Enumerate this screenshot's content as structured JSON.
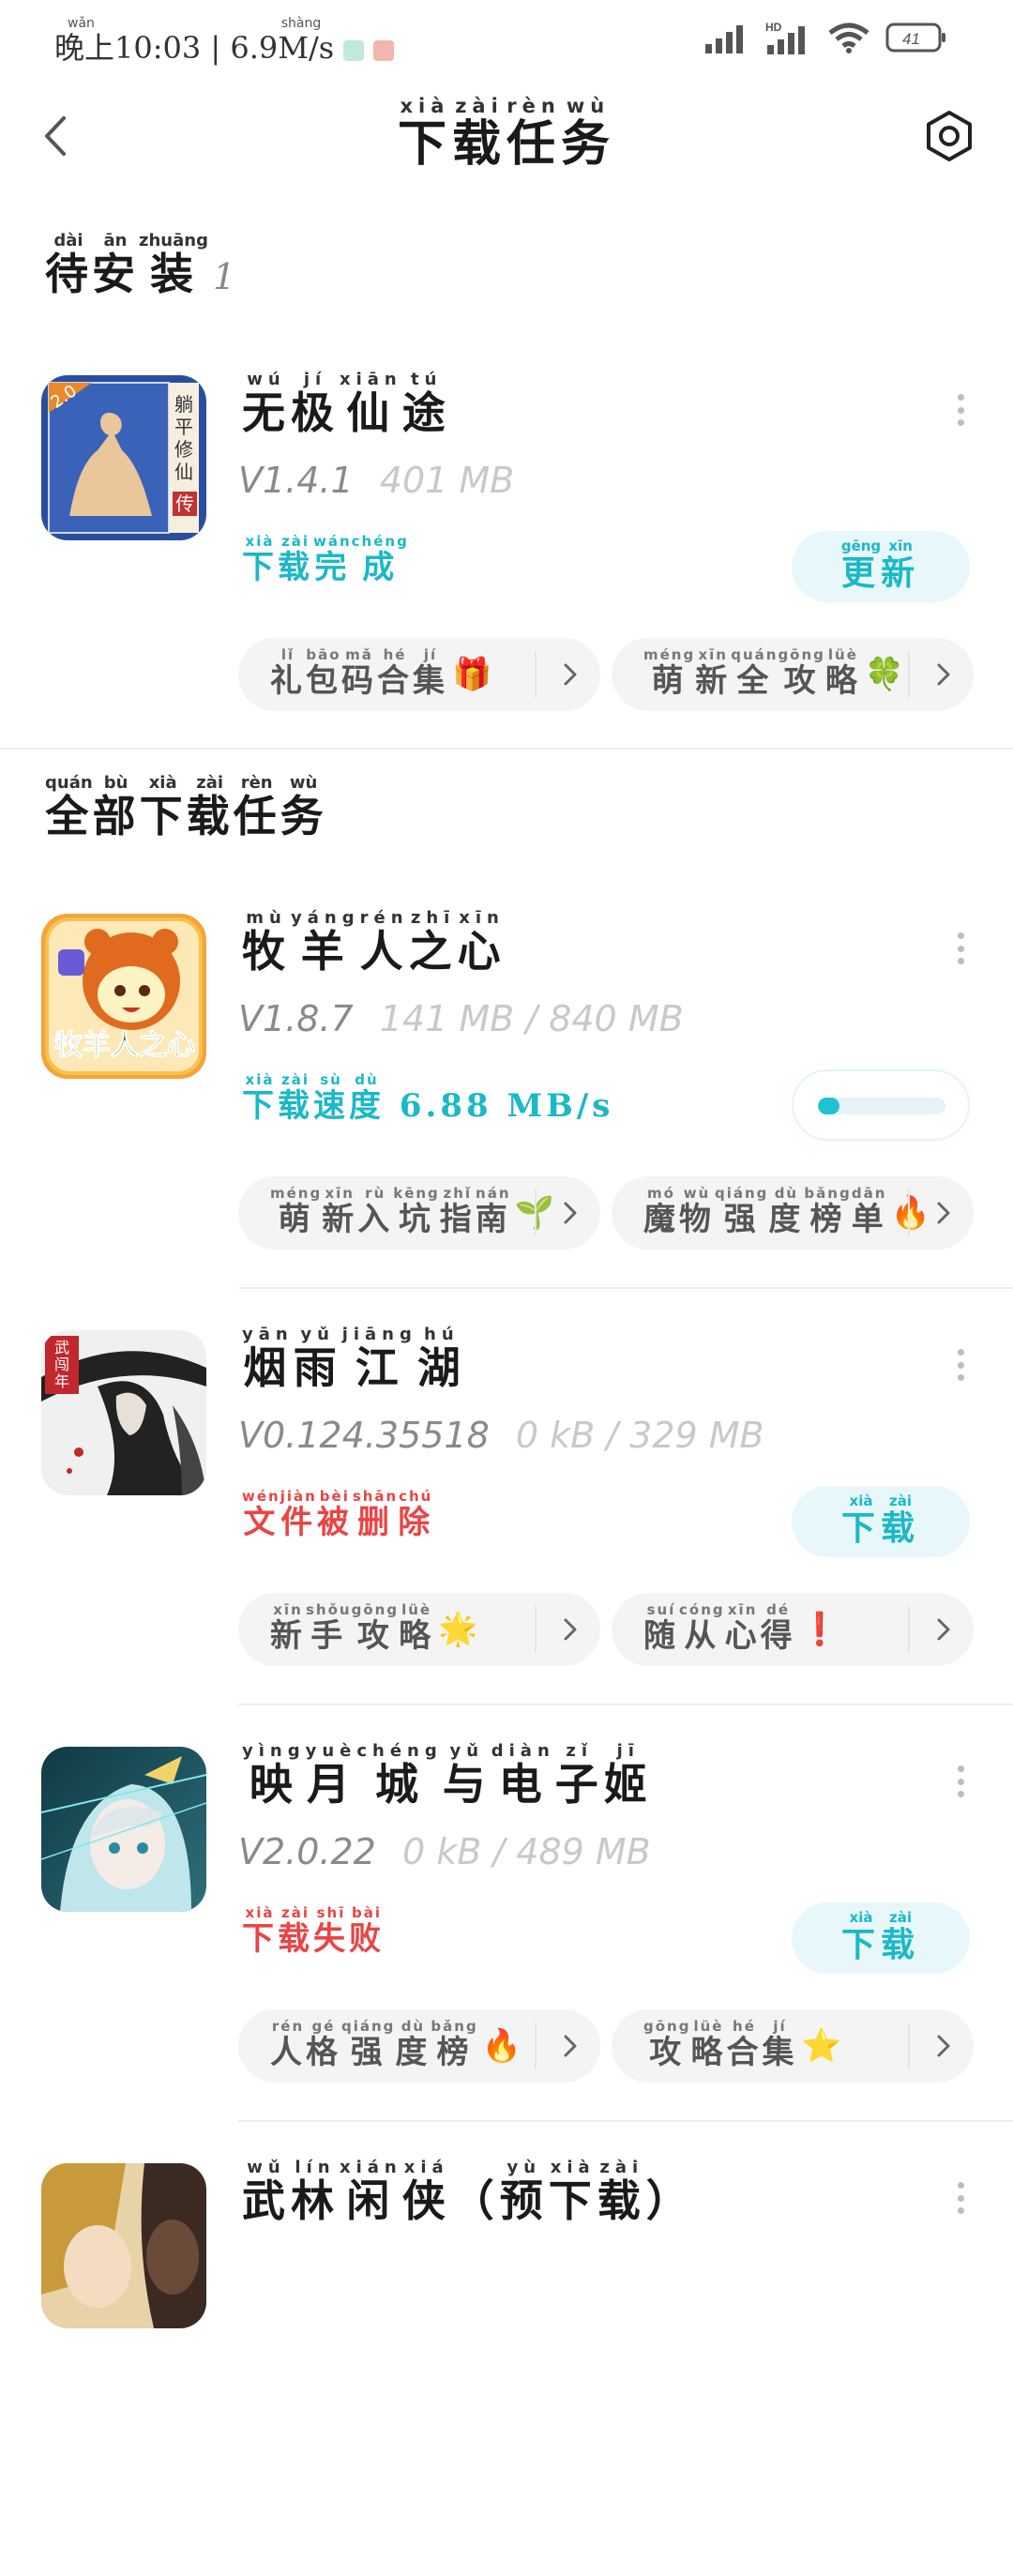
{
  "status_bar": {
    "time_pinyin": "wǎn shàng",
    "time_label": "晚上10:03 | 6.9M/s",
    "battery": "41"
  },
  "header": {
    "title_chars": [
      {
        "c": "下",
        "p": "xià"
      },
      {
        "c": "载",
        "p": "zài"
      },
      {
        "c": "任",
        "p": "rèn"
      },
      {
        "c": "务",
        "p": "wù"
      }
    ]
  },
  "pending_section": {
    "title_chars": [
      {
        "c": "待",
        "p": "dài"
      },
      {
        "c": "安",
        "p": "ān"
      },
      {
        "c": "装",
        "p": "zhuāng"
      }
    ],
    "count": "1"
  },
  "all_section": {
    "title_chars": [
      {
        "c": "全",
        "p": "quán"
      },
      {
        "c": "部",
        "p": "bù"
      },
      {
        "c": "下",
        "p": "xià"
      },
      {
        "c": "载",
        "p": "zài"
      },
      {
        "c": "任",
        "p": "rèn"
      },
      {
        "c": "务",
        "p": "wù"
      }
    ]
  },
  "apps": [
    {
      "name": [
        {
          "c": "无",
          "p": "wú"
        },
        {
          "c": "极",
          "p": "jí"
        },
        {
          "c": "仙",
          "p": "xiān"
        },
        {
          "c": "途",
          "p": "tú"
        }
      ],
      "version": "V1.4.1",
      "size": "401 MB",
      "status_type": "ok",
      "status": [
        {
          "c": "下",
          "p": "xià"
        },
        {
          "c": "载",
          "p": "zài"
        },
        {
          "c": "完",
          "p": "wán"
        },
        {
          "c": "成",
          "p": "chéng"
        }
      ],
      "action": [
        {
          "c": "更",
          "p": "gēng"
        },
        {
          "c": "新",
          "p": "xīn"
        }
      ],
      "icon_colors": [
        "#2a4e9e",
        "#e9c79a",
        "#c2322e"
      ],
      "icon_badge": "2.0",
      "icon_side": "躺平修仙",
      "icon_seal": "传",
      "chips": [
        {
          "text": [
            {
              "c": "礼",
              "p": "lǐ"
            },
            {
              "c": "包",
              "p": "bāo"
            },
            {
              "c": "码",
              "p": "mǎ"
            },
            {
              "c": "合",
              "p": "hé"
            },
            {
              "c": "集",
              "p": "jí"
            }
          ],
          "emoji": "🎁"
        },
        {
          "text": [
            {
              "c": "萌",
              "p": "méng"
            },
            {
              "c": "新",
              "p": "xīn"
            },
            {
              "c": "全",
              "p": "quán"
            },
            {
              "c": "攻",
              "p": "gōng"
            },
            {
              "c": "略",
              "p": "lüè"
            }
          ],
          "emoji": "🍀"
        }
      ]
    },
    {
      "name": [
        {
          "c": "牧",
          "p": "mù"
        },
        {
          "c": "羊",
          "p": "yáng"
        },
        {
          "c": "人",
          "p": "rén"
        },
        {
          "c": "之",
          "p": "zhī"
        },
        {
          "c": "心",
          "p": "xīn"
        }
      ],
      "version": "V1.8.7",
      "size": "141 MB / 840 MB",
      "status_type": "ok",
      "status": [
        {
          "c": "下",
          "p": "xià"
        },
        {
          "c": "载",
          "p": "zài"
        },
        {
          "c": "速",
          "p": "sù"
        },
        {
          "c": "度",
          "p": "dù"
        }
      ],
      "status_suffix": " 6.88 MB/s",
      "progress": 0.17,
      "icon_colors": [
        "#f4a43a",
        "#e06a1e",
        "#fff3c4"
      ],
      "icon_text": "牧羊人之心",
      "chips": [
        {
          "text": [
            {
              "c": "萌",
              "p": "méng"
            },
            {
              "c": "新",
              "p": "xīn"
            },
            {
              "c": "入",
              "p": "rù"
            },
            {
              "c": "坑",
              "p": "kēng"
            },
            {
              "c": "指",
              "p": "zhǐ"
            },
            {
              "c": "南",
              "p": "nán"
            }
          ],
          "emoji": "🌱"
        },
        {
          "text": [
            {
              "c": "魔",
              "p": "mó"
            },
            {
              "c": "物",
              "p": "wù"
            },
            {
              "c": "强",
              "p": "qiáng"
            },
            {
              "c": "度",
              "p": "dù"
            },
            {
              "c": "榜",
              "p": "bǎng"
            },
            {
              "c": "单",
              "p": "dān"
            }
          ],
          "emoji": "🔥"
        }
      ]
    },
    {
      "name": [
        {
          "c": "烟",
          "p": "yān"
        },
        {
          "c": "雨",
          "p": "yǔ"
        },
        {
          "c": "江",
          "p": "jiāng"
        },
        {
          "c": "湖",
          "p": "hú"
        }
      ],
      "version": "V0.124.35518",
      "size": "0 kB / 329 MB",
      "status_type": "err",
      "status": [
        {
          "c": "文",
          "p": "wén"
        },
        {
          "c": "件",
          "p": "jiàn"
        },
        {
          "c": "被",
          "p": "bèi"
        },
        {
          "c": "删",
          "p": "shān"
        },
        {
          "c": "除",
          "p": "chú"
        }
      ],
      "action": [
        {
          "c": "下",
          "p": "xià"
        },
        {
          "c": "载",
          "p": "zài"
        }
      ],
      "icon_colors": [
        "#f0f0f0",
        "#222222",
        "#c0282c"
      ],
      "icon_seal": "武闯年",
      "chips": [
        {
          "text": [
            {
              "c": "新",
              "p": "xīn"
            },
            {
              "c": "手",
              "p": "shǒu"
            },
            {
              "c": "攻",
              "p": "gōng"
            },
            {
              "c": "略",
              "p": "lüè"
            }
          ],
          "emoji": "🌟"
        },
        {
          "text": [
            {
              "c": "随",
              "p": "suí"
            },
            {
              "c": "从",
              "p": "cóng"
            },
            {
              "c": "心",
              "p": "xīn"
            },
            {
              "c": "得",
              "p": "dé"
            }
          ],
          "emoji": "❗"
        }
      ]
    },
    {
      "name": [
        {
          "c": "映",
          "p": "yìng"
        },
        {
          "c": "月",
          "p": "yuè"
        },
        {
          "c": "城",
          "p": "chéng"
        },
        {
          "c": "与",
          "p": "yǔ"
        },
        {
          "c": "电",
          "p": "diàn"
        },
        {
          "c": "子",
          "p": "zǐ"
        },
        {
          "c": "姬",
          "p": "jī"
        }
      ],
      "version": "V2.0.22",
      "size": "0 kB / 489 MB",
      "status_type": "err",
      "status": [
        {
          "c": "下",
          "p": "xià"
        },
        {
          "c": "载",
          "p": "zài"
        },
        {
          "c": "失",
          "p": "shī"
        },
        {
          "c": "败",
          "p": "bài"
        }
      ],
      "action": [
        {
          "c": "下",
          "p": "xià"
        },
        {
          "c": "载",
          "p": "zài"
        }
      ],
      "icon_colors": [
        "#2f6f7a",
        "#bfe6ea",
        "#f2d36b"
      ],
      "chips": [
        {
          "text": [
            {
              "c": "人",
              "p": "rén"
            },
            {
              "c": "格",
              "p": "gé"
            },
            {
              "c": "强",
              "p": "qiáng"
            },
            {
              "c": "度",
              "p": "dù"
            },
            {
              "c": "榜",
              "p": "bǎng"
            }
          ],
          "emoji": "🔥"
        },
        {
          "text": [
            {
              "c": "攻",
              "p": "gōng"
            },
            {
              "c": "略",
              "p": "lüè"
            },
            {
              "c": "合",
              "p": "hé"
            },
            {
              "c": "集",
              "p": "jí"
            }
          ],
          "emoji": "⭐"
        }
      ]
    },
    {
      "name": [
        {
          "c": "武",
          "p": "wǔ"
        },
        {
          "c": "林",
          "p": "lín"
        },
        {
          "c": "闲",
          "p": "xián"
        },
        {
          "c": "侠",
          "p": "xiá"
        },
        {
          "c": "（",
          "p": ""
        },
        {
          "c": "预",
          "p": "yù"
        },
        {
          "c": "下",
          "p": "xià"
        },
        {
          "c": "载",
          "p": "zài"
        },
        {
          "c": "）",
          "p": ""
        }
      ],
      "icon_colors": [
        "#c89a3c",
        "#3b2a22",
        "#e8d3a8"
      ]
    }
  ]
}
